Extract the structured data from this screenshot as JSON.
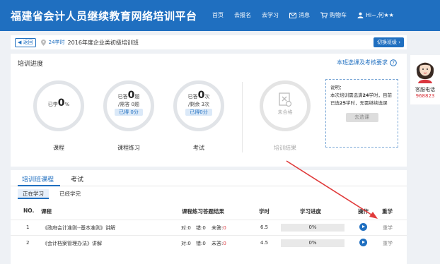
{
  "header": {
    "brand": "福建省会计人员继续教育网络培训平台",
    "nav": [
      "首页",
      "去报名",
      "去学习"
    ],
    "messages": "消息",
    "cart": "购物车",
    "user": "Hi~,何★★"
  },
  "subbar": {
    "back": "返回",
    "hours": "24学时",
    "course": "2016年度企业类初级培训班",
    "switch": "切换班级"
  },
  "progress": {
    "title": "培训进度",
    "requirements_link": "本班选课及考核要求",
    "course": {
      "prefix": "已学",
      "value": "0",
      "unit": "%",
      "label": "课程"
    },
    "practice": {
      "answered_prefix": "已答",
      "answered": "0",
      "answered_unit": "题",
      "required": "/需答 0题",
      "score": "已得 0分",
      "label": "课程练习"
    },
    "exam": {
      "taken_prefix": "已答",
      "taken": "0",
      "taken_unit": "次",
      "remaining": "/剩余 3次",
      "score": "已得0分",
      "label": "考试"
    },
    "result": {
      "status": "未合格",
      "label": "培训结果"
    },
    "note": {
      "title": "说明：",
      "text_1": "本次培训需选满",
      "bold_1": "24",
      "text_2": "学时，目前已选",
      "bold_2": "25",
      "text_3": "学时，无需继续选课",
      "button": "去选课"
    }
  },
  "service": {
    "label": "客服电话",
    "phone": "968823"
  },
  "list": {
    "tabs": [
      "培训班课程",
      "考试"
    ],
    "subtabs": [
      "正在学习",
      "已经学完"
    ],
    "headers": {
      "no": "NO.",
      "course": "课程",
      "results": "课程练习答题结果",
      "hours": "学时",
      "progress": "学习进度",
      "action": "操作",
      "required": "重学"
    },
    "rows": [
      {
        "no": "1",
        "course": "《政府会计准则--基本准则》讲解",
        "correct": "对:0",
        "wrong": "错:0",
        "unanswered_label": "未答:",
        "unanswered": "0",
        "hours": "6.5",
        "progress_text": "0%",
        "progress": 0,
        "type": "重学"
      },
      {
        "no": "2",
        "course": "《会计档案管理办法》讲解",
        "correct": "对:0",
        "wrong": "错:0",
        "unanswered_label": "未答:",
        "unanswered": "0",
        "hours": "4.5",
        "progress_text": "0%",
        "progress": 0,
        "type": "重学"
      }
    ]
  },
  "colors": {
    "primary": "#1f6fc0",
    "accent_red": "#d9363e",
    "background": "#eef1f5"
  }
}
